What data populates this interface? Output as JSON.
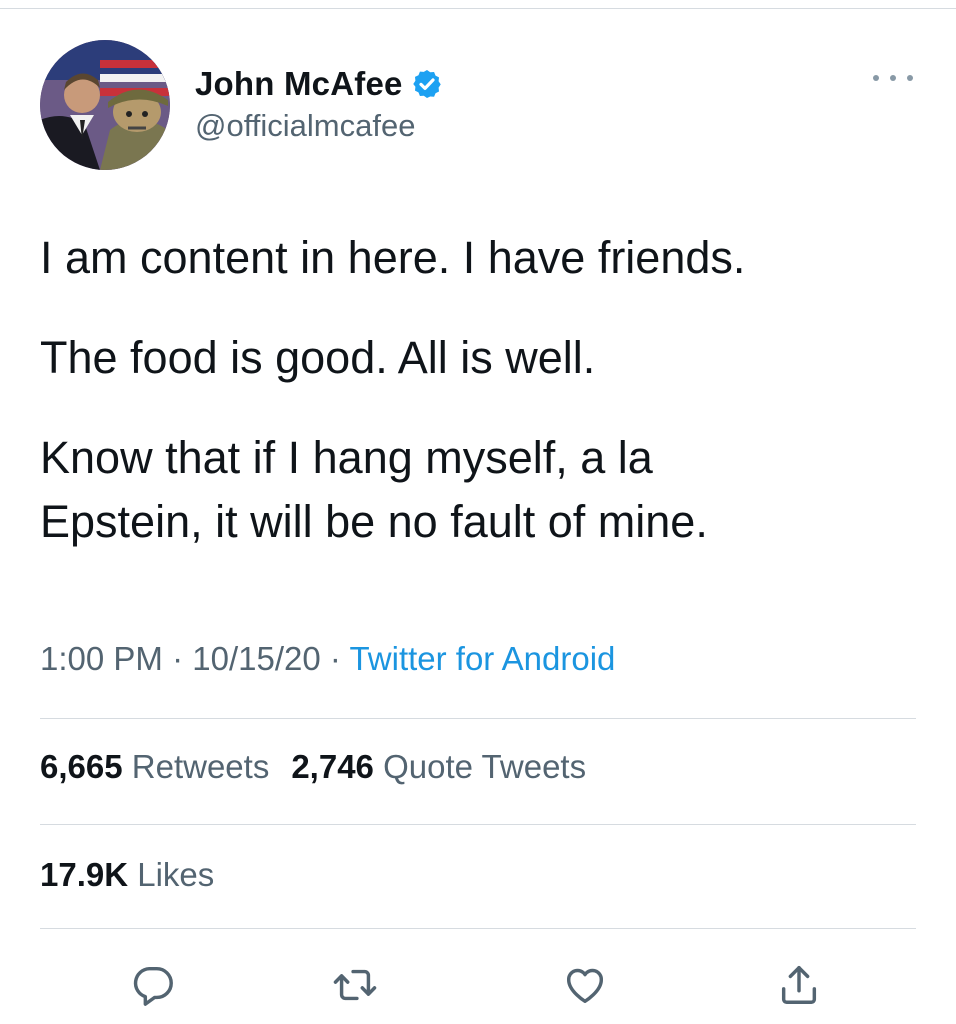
{
  "tweet": {
    "author": {
      "display_name": "John McAfee",
      "handle": "@officialmcafee",
      "verified": true
    },
    "text_paragraphs": [
      "I am content in here. I have friends.",
      "The food is good. All is well.",
      "Know that if I hang myself, a la",
      "Epstein, it will be no fault of mine."
    ],
    "time": "1:00 PM",
    "separator": " · ",
    "date": "10/15/20",
    "source": "Twitter for Android",
    "stats": {
      "retweets_count": "6,665",
      "retweets_label": "Retweets",
      "quote_tweets_count": "2,746",
      "quote_tweets_label": "Quote Tweets",
      "likes_count": "17.9K",
      "likes_label": "Likes"
    },
    "actions": [
      "reply-icon",
      "retweet-icon",
      "like-icon",
      "share-icon"
    ]
  },
  "colors": {
    "link": "#1b95e0",
    "verified": "#1da1f2",
    "secondary_text": "#536471",
    "divider": "#d6dbe0"
  }
}
